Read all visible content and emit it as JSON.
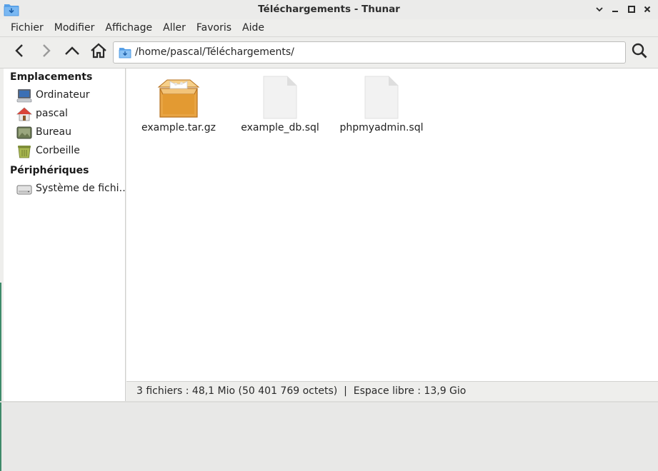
{
  "window": {
    "title": "Téléchargements - Thunar",
    "controls": [
      "minimize-icon",
      "maximize-icon",
      "close-icon"
    ]
  },
  "menubar": {
    "items": [
      "Fichier",
      "Modifier",
      "Affichage",
      "Aller",
      "Favoris",
      "Aide"
    ]
  },
  "toolbar": {
    "buttons": [
      "back-arrow-icon",
      "forward-arrow-icon",
      "parent-folder-icon",
      "home-icon"
    ],
    "location": "/home/pascal/Téléchargements/",
    "search": "search-icon"
  },
  "sidebar": {
    "sections": [
      {
        "heading": "Emplacements",
        "items": [
          {
            "label": "Ordinateur",
            "icon": "computer-icon"
          },
          {
            "label": "pascal",
            "icon": "home-folder-icon"
          },
          {
            "label": "Bureau",
            "icon": "desktop-icon"
          },
          {
            "label": "Corbeille",
            "icon": "trash-icon"
          }
        ]
      },
      {
        "heading": "Périphériques",
        "items": [
          {
            "label": "Système de fichi…",
            "icon": "drive-icon"
          }
        ]
      }
    ]
  },
  "files": [
    {
      "name": "example.tar.gz",
      "icon": "archive-icon"
    },
    {
      "name": "example_db.sql",
      "icon": "document-icon"
    },
    {
      "name": "phpmyadmin.sql",
      "icon": "document-icon"
    }
  ],
  "statusbar": {
    "text": "3 fichiers : 48,1 Mio (50 401 769 octets)  |  Espace libre : 13,9 Gio"
  },
  "colors": {
    "accent_blue": "#3d8ee0",
    "archive_orange": "#e8a443",
    "window_bg": "#eeeeec"
  }
}
